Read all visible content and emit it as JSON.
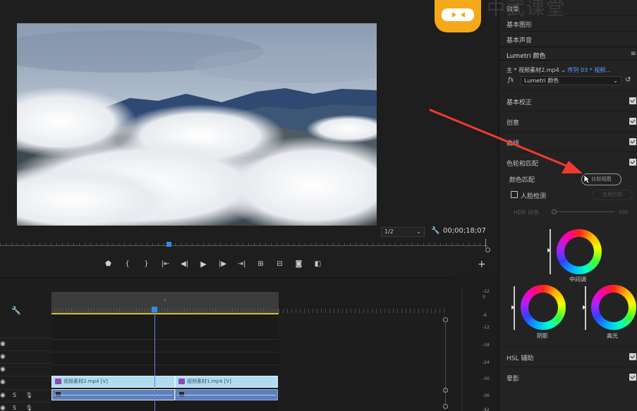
{
  "monitor": {
    "fit_select": "1/2",
    "timecode": "00;00;18;07"
  },
  "transport": {
    "icons": [
      "marker-icon",
      "in-point-icon",
      "out-point-icon",
      "go-to-in-icon",
      "step-back-icon",
      "play-icon",
      "step-forward-icon",
      "go-to-out-icon",
      "insert-icon",
      "overwrite-icon",
      "export-frame-icon",
      "compare-icon"
    ],
    "glyphs": [
      "⬟",
      "{",
      "}",
      "|⇤",
      "◀|",
      "▶",
      "|▶",
      "⇥|",
      "⊞",
      "⊟",
      "◙",
      "◧"
    ],
    "add": "+"
  },
  "timeline": {
    "track_labels": {
      "s": "S"
    },
    "clip_v1": "视频素材2.mp4 [V]",
    "clip_v2": "视频素材1.mp4 [V]"
  },
  "meter": {
    "ticks": [
      "-12",
      "0",
      "-6",
      "-12",
      "-18",
      "-24",
      "-30",
      "-36",
      "-42"
    ]
  },
  "panel": {
    "menu": [
      "效果",
      "基本图形",
      "基本声音"
    ],
    "lumetri_title": "Lumetri 颜色",
    "source_prefix": "主 *",
    "source_clip": "视频素材2.mp4",
    "sequence": "序列 03 * 视频...",
    "fx_effect": "Lumetri 颜色",
    "sections": [
      "基本校正",
      "创意",
      "曲线",
      "色轮和匹配"
    ],
    "color_match_label": "颜色匹配",
    "compare_button": "比较视图",
    "face_detect": "人脸检测",
    "apply_button": "应用匹配",
    "hdr_label": "HDR 白色",
    "hdr_value": "100",
    "wheels": {
      "mid": "中间调",
      "shadow": "阴影",
      "highlight": "高光"
    },
    "hsl": "HSL 辅助",
    "vignette": "晕影"
  },
  "overlay": {
    "watermark": "中武课堂"
  }
}
